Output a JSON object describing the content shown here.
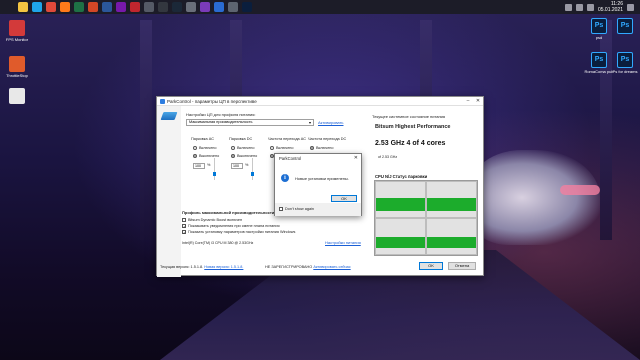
{
  "taskbar": {
    "icons": [
      {
        "name": "file-explorer-icon",
        "color": "#f4c542"
      },
      {
        "name": "edge-icon",
        "color": "#1fa5e8"
      },
      {
        "name": "chrome-icon",
        "color": "#e04a3a"
      },
      {
        "name": "firefox-icon",
        "color": "#ff7a1a"
      },
      {
        "name": "excel-icon",
        "color": "#1e7145"
      },
      {
        "name": "powerpoint-icon",
        "color": "#d24726"
      },
      {
        "name": "word-icon",
        "color": "#2b579a"
      },
      {
        "name": "onenote-icon",
        "color": "#7719aa"
      },
      {
        "name": "app-red-icon",
        "color": "#c0262e"
      },
      {
        "name": "calculator-icon",
        "color": "#555a66"
      },
      {
        "name": "app-dark-icon",
        "color": "#33373f"
      },
      {
        "name": "steam-icon",
        "color": "#1b2838"
      },
      {
        "name": "app-grey-icon",
        "color": "#6a6f7a"
      },
      {
        "name": "app-purple-icon",
        "color": "#7a3bb8"
      },
      {
        "name": "app-blue-icon",
        "color": "#2a6bd1"
      },
      {
        "name": "settings-icon",
        "color": "#5d6470"
      },
      {
        "name": "photoshop-icon",
        "color": "#0a1e3d"
      }
    ],
    "clock_time": "11:26",
    "clock_date": "05.01.2021"
  },
  "desktop_left": [
    {
      "label": "FPS Monitor",
      "color": "#d33a3a"
    },
    {
      "label": "ThrottleStop",
      "color": "#e05b2b"
    },
    {
      "label": "",
      "color": "#dddddd"
    }
  ],
  "desktop_right": [
    {
      "label": "psd",
      "glyph": "Ps"
    },
    {
      "label": "",
      "glyph": "Ps"
    },
    {
      "label": "RomaComa pub",
      "glyph": "Ps"
    },
    {
      "label": "Ps for dreams",
      "glyph": "Ps"
    }
  ],
  "window": {
    "title": "ParkControl - параметры ЦП в перспективе",
    "cpu_label": "Настройки ЦП для профиля питания:",
    "profile_value": "Максимальная производительность",
    "activate_link": "Активировать",
    "columns": [
      {
        "title": "Парковка AC",
        "options": [
          "Включено",
          "Выключено"
        ],
        "selected": 1,
        "value": "100",
        "unit": "%",
        "slider_level": 1.0
      },
      {
        "title": "Парковка DC",
        "options": [
          "Включено",
          "Выключено"
        ],
        "selected": 1,
        "value": "100",
        "unit": "%",
        "slider_level": 1.0
      },
      {
        "title": "Частота перехода AC",
        "options": [
          "Включено",
          "Выключено"
        ],
        "selected": 1,
        "value": "",
        "unit": "",
        "slider_level": 1.0
      },
      {
        "title": "Частота перехода DC",
        "options": [
          "Включено",
          "Выключено"
        ],
        "selected": 0,
        "value": "",
        "unit": "",
        "slider_level": 1.0
      }
    ],
    "profile_section_title": "Профиль максимальной производительности",
    "checkboxes": [
      {
        "label": "Bitsum Dynamic Boost включен",
        "checked": false
      },
      {
        "label": "Показывать уведомления при смене плана питания",
        "checked": true
      },
      {
        "label": "Показать установку параметров настройки питания Windows",
        "checked": true
      }
    ],
    "cpu_name": "Intel(R) Core(TM) i3 CPU       M 380 @ 2.53GHz",
    "power_settings_link": "Настройки питания",
    "footer_version_label": "Текущая версия: 1.5.1.8.",
    "footer_new_version_label": "Новая версия: 1.5.1.8.",
    "footer_unregistered": "НЕ ЗАРЕГИСТРИРОВАНО",
    "footer_activate_link": "Активировать сейчас",
    "ok_label": "OK",
    "cancel_label": "Отмена",
    "right_header": "Текущее системное состояние питания",
    "plan_name": "Bitsum Highest Performance",
    "freq_line": "2.53 GHz    4 of 4 cores",
    "base_freq": "of 2.53 GHz",
    "graph_title": "CPU N/J Статус парковки",
    "core_loads": [
      0.7,
      0.7,
      0.55,
      0.55
    ]
  },
  "dialog": {
    "title": "ParkControl",
    "message": "Новые установки применены.",
    "ok_label": "OK",
    "checkbox_label": "Don't show again"
  },
  "colors": {
    "accent": "#0078d7",
    "parked_green": "#1cac2c",
    "link_blue": "#1a5fd6"
  }
}
